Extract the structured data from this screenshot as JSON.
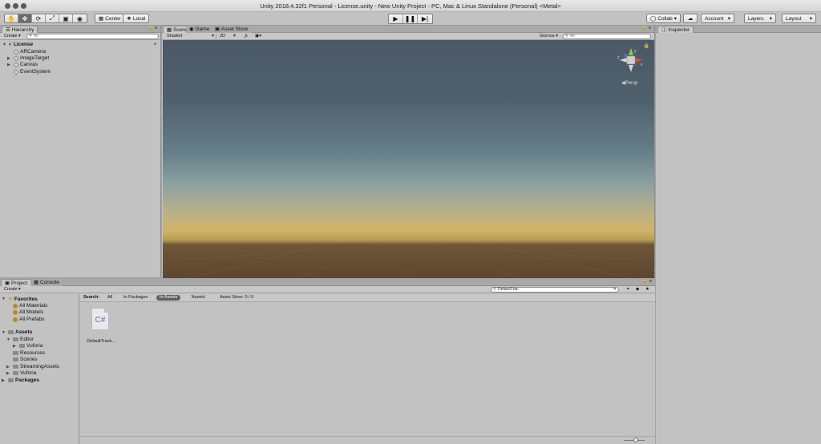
{
  "window": {
    "title": "Unity 2018.4.32f1 Personal - License.unity - New Unity Project - PC, Mac & Linux Standalone (Personal) <Metal>"
  },
  "toolbar": {
    "transform_tools": [
      "hand-icon",
      "move-icon",
      "rotate-icon",
      "scale-icon",
      "rect-icon",
      "transform-icon"
    ],
    "pivot_label": "Center",
    "space_label": "Local",
    "collab_label": "Collab",
    "account_label": "Account",
    "layers_label": "Layers",
    "layout_label": "Layout"
  },
  "hierarchy": {
    "tab": "Hierarchy",
    "create_label": "Create",
    "search_placeholder": "All",
    "scene_name": "License",
    "items": [
      {
        "label": "ARCamera",
        "expandable": false
      },
      {
        "label": "ImageTarget",
        "expandable": true
      },
      {
        "label": "Canvas",
        "expandable": true
      },
      {
        "label": "EventSystem",
        "expandable": false
      }
    ]
  },
  "scene": {
    "tabs": [
      "Scene",
      "Game",
      "Asset Store"
    ],
    "shading_mode": "Shaded",
    "mode_2d": "2D",
    "gizmos_label": "Gizmos",
    "search_placeholder": "All",
    "gizmo": {
      "x": "x",
      "y": "y",
      "z": "z",
      "projection": "Persp"
    }
  },
  "inspector": {
    "tab": "Inspector"
  },
  "project": {
    "tabs": [
      "Project",
      "Console"
    ],
    "create_label": "Create",
    "search_value": "DefaultTrac",
    "favorites_label": "Favorites",
    "favorites": [
      "All Materials",
      "All Models",
      "All Prefabs"
    ],
    "assets_label": "Assets",
    "assets_tree": [
      {
        "label": "Editor",
        "depth": 1,
        "expanded": true
      },
      {
        "label": "Vuforia",
        "depth": 2,
        "expanded": false
      },
      {
        "label": "Resources",
        "depth": 1,
        "expanded": null
      },
      {
        "label": "Scenes",
        "depth": 1,
        "expanded": null
      },
      {
        "label": "StreamingAssets",
        "depth": 1,
        "expanded": false
      },
      {
        "label": "Vuforia",
        "depth": 1,
        "expanded": false
      }
    ],
    "packages_label": "Packages",
    "search_bar": {
      "label": "Search:",
      "scopes": [
        "All",
        "In Packages",
        "In Assets"
      ],
      "active_scope": "In Assets",
      "folder_scope": "'Assets'",
      "asset_store": "Asset Store: 0 / 0"
    },
    "results": [
      {
        "icon_text": "C#",
        "name": "DefaultTrack..."
      }
    ]
  }
}
